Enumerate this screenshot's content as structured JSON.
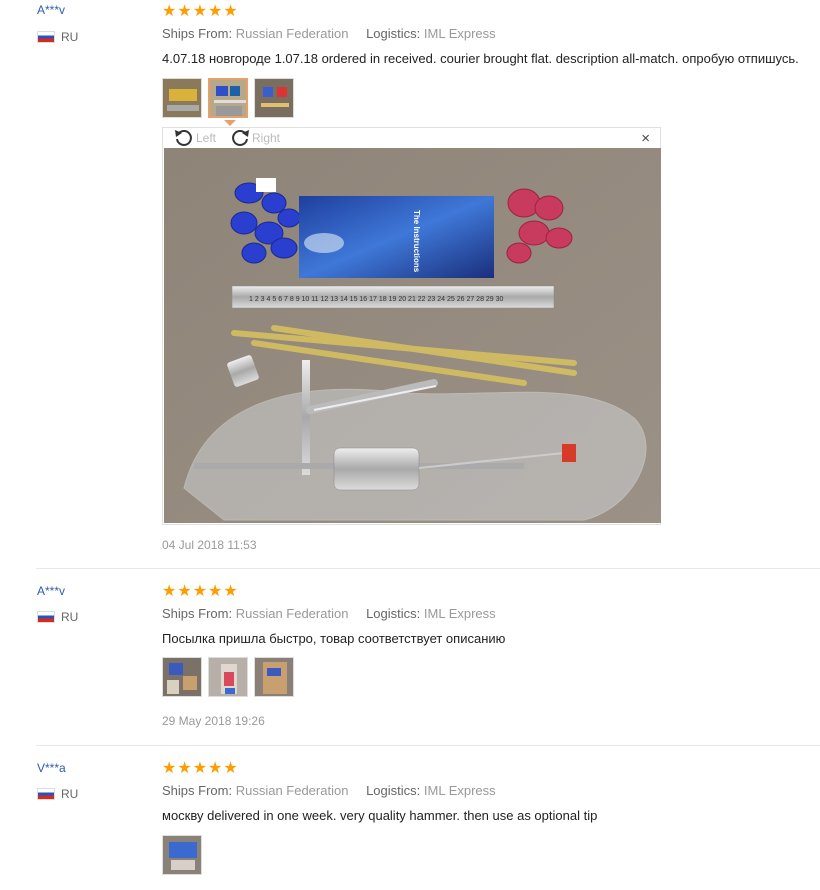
{
  "reviews": [
    {
      "user": "A***v",
      "country": "RU",
      "stars": "★★★★★",
      "ships_label": "Ships From:",
      "ships_value": "Russian Federation",
      "logistics_label": "Logistics:",
      "logistics_value": "IML Express",
      "text": "4.07.18 новгороде 1.07.18 ordered in received. courier brought flat. description all-match. опробую отпишусь.",
      "date": "04 Jul 2018 11:53"
    },
    {
      "user": "A***v",
      "country": "RU",
      "stars": "★★★★★",
      "ships_label": "Ships From:",
      "ships_value": "Russian Federation",
      "logistics_label": "Logistics:",
      "logistics_value": "IML Express",
      "text": "Посылка пришла быстро, товар соответствует описанию",
      "date": "29 May 2018 19:26"
    },
    {
      "user": "V***a",
      "country": "RU",
      "stars": "★★★★★",
      "ships_label": "Ships From:",
      "ships_value": "Russian Federation",
      "logistics_label": "Logistics:",
      "logistics_value": "IML Express",
      "text": "москву delivered in one week. very quality hammer. then use as optional tip"
    }
  ],
  "viewer": {
    "rotate_left": "Left",
    "rotate_right": "Right",
    "close": "×"
  },
  "photo_printed": {
    "booklet_title": "The Instructions",
    "ruler_numbers": "1 2 3 4 5 6 7 8 9 10 11 12 13 14 15 16 17 18 19 20 21 22 23 24 25 26 27 28 29 30"
  },
  "colors": {
    "star": "#ff9c00",
    "username": "#2a5db0",
    "active_thumb_border": "#e8a06a"
  }
}
